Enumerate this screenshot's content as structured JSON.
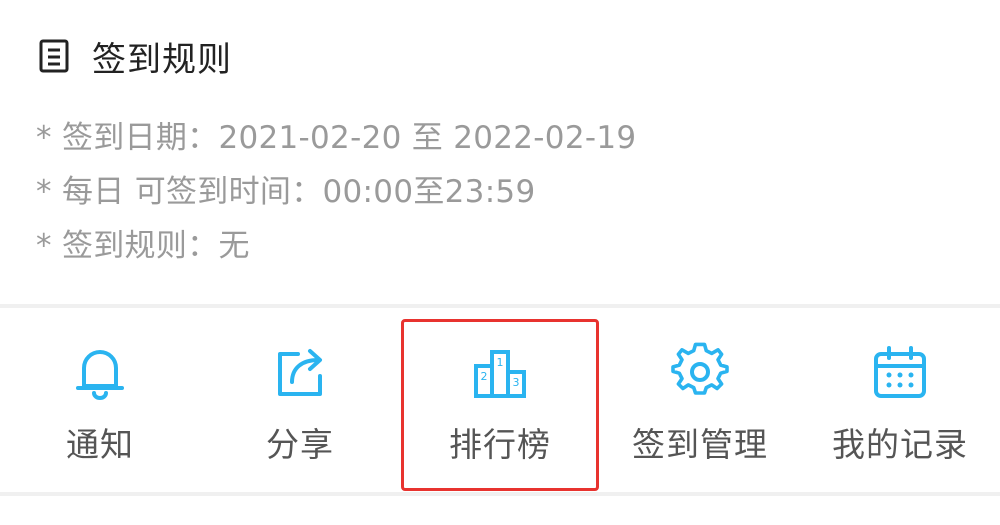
{
  "rules": {
    "title": "签到规则",
    "lines": [
      "* 签到日期：2021-02-20 至 2022-02-19",
      "* 每日 可签到时间：00:00至23:59",
      "* 签到规则：无"
    ]
  },
  "menu": {
    "items": [
      {
        "label": "通知",
        "icon": "bell-icon"
      },
      {
        "label": "分享",
        "icon": "share-icon"
      },
      {
        "label": "排行榜",
        "icon": "podium-icon"
      },
      {
        "label": "签到管理",
        "icon": "gear-icon"
      },
      {
        "label": "我的记录",
        "icon": "calendar-icon"
      }
    ]
  },
  "colors": {
    "icon_accent": "#2ab4f0",
    "highlight": "#e8332f"
  }
}
